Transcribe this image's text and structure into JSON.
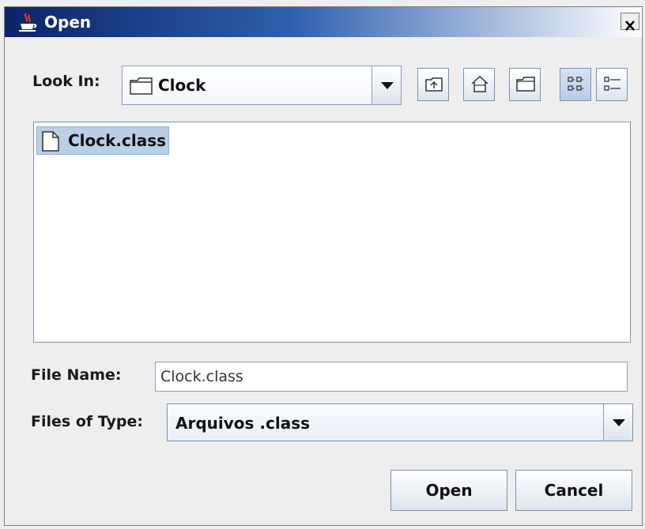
{
  "window": {
    "title": "Open",
    "close_symbol": "×"
  },
  "look_in": {
    "label": "Look In:",
    "value": "Clock"
  },
  "toolbar": {
    "buttons": [
      "up-folder-icon",
      "home-icon",
      "new-folder-icon",
      "list-view-icon",
      "details-view-icon"
    ]
  },
  "files": [
    {
      "name": "Clock.class",
      "selected": true
    }
  ],
  "file_name": {
    "label": "File Name:",
    "value": "Clock.class"
  },
  "file_type": {
    "label": "Files of Type:",
    "value": "Arquivos .class"
  },
  "buttons": {
    "open": "Open",
    "cancel": "Cancel"
  },
  "colors": {
    "selection": "#b8cfe5",
    "title_bar": "#0a2467",
    "border": "#7b93b2"
  }
}
